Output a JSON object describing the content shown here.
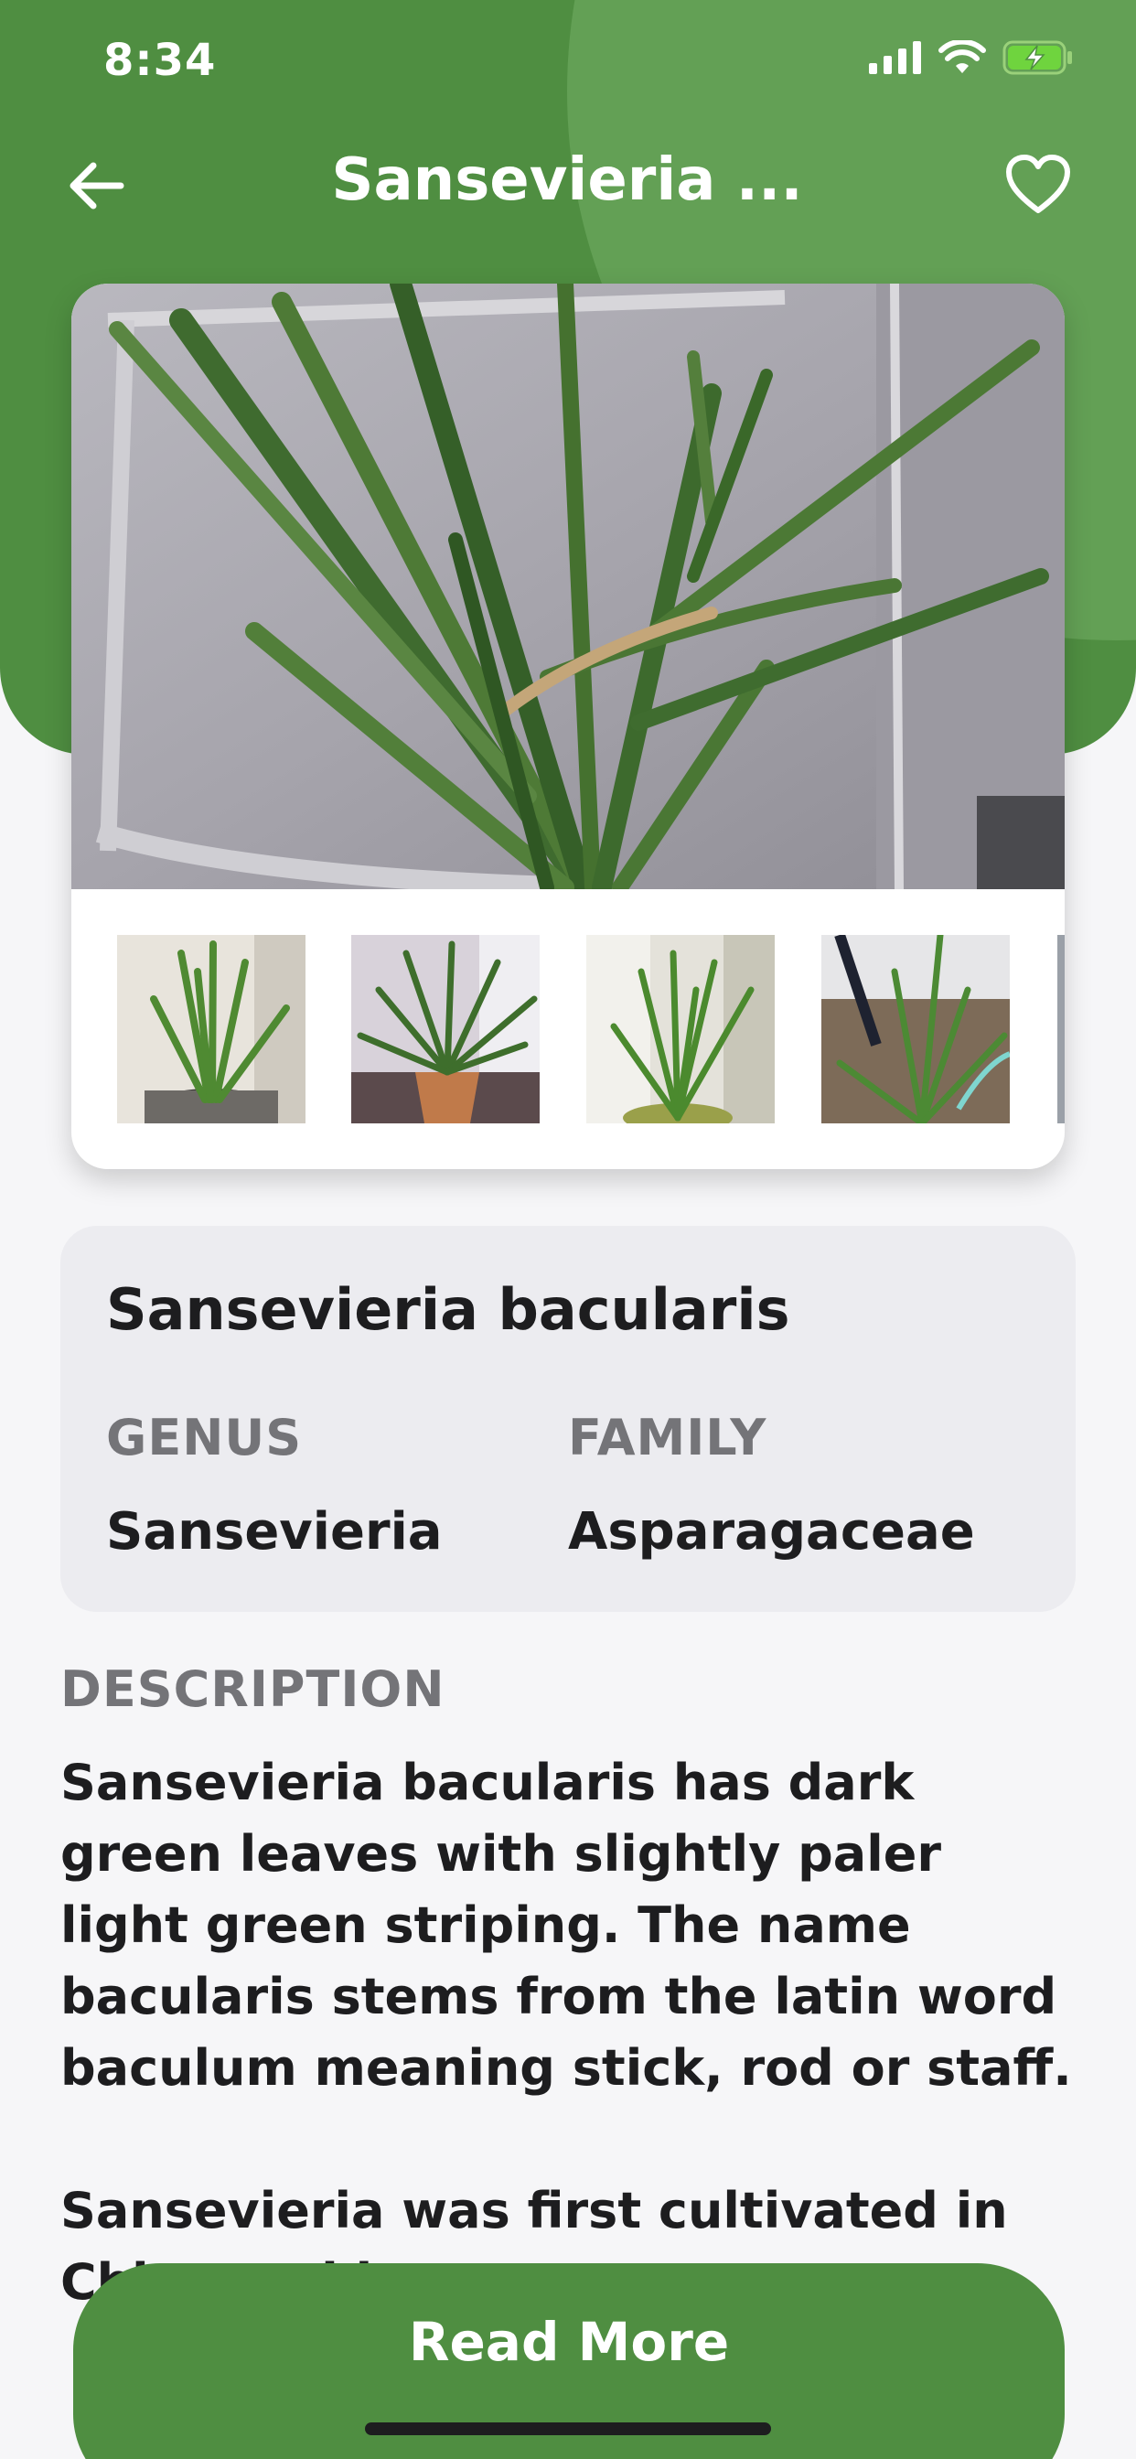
{
  "status_bar": {
    "time": "8:34"
  },
  "nav": {
    "title": "Sansevieria ...",
    "back_icon": "arrow-left-icon",
    "favorite_icon": "heart-outline-icon"
  },
  "gallery": {
    "main_photo": "plant-photo",
    "thumbnails": [
      "thumbnail-1",
      "thumbnail-2",
      "thumbnail-3",
      "thumbnail-4"
    ]
  },
  "info": {
    "name": "Sansevieria bacularis",
    "genus_label": "GENUS",
    "genus_value": "Sansevieria",
    "family_label": "FAMILY",
    "family_value": "Asparagaceae"
  },
  "description": {
    "label": "DESCRIPTION",
    "paragraph_1": "Sansevieria bacularis has dark green leaves with slightly paler light green striping. The name bacularis stems from the latin word baculum meaning stick, rod or staff.",
    "paragraph_2": "Sansevieria was first cultivated in China and later came to...",
    "paragraph_2_visible_start": "Sansevieria was first cultivated in"
  },
  "actions": {
    "read_more": "Read More"
  },
  "colors": {
    "brand_green": "#4f8e41",
    "brand_green_light": "#63a055",
    "card_bg": "#ececf0",
    "page_bg": "#f6f6f8"
  }
}
